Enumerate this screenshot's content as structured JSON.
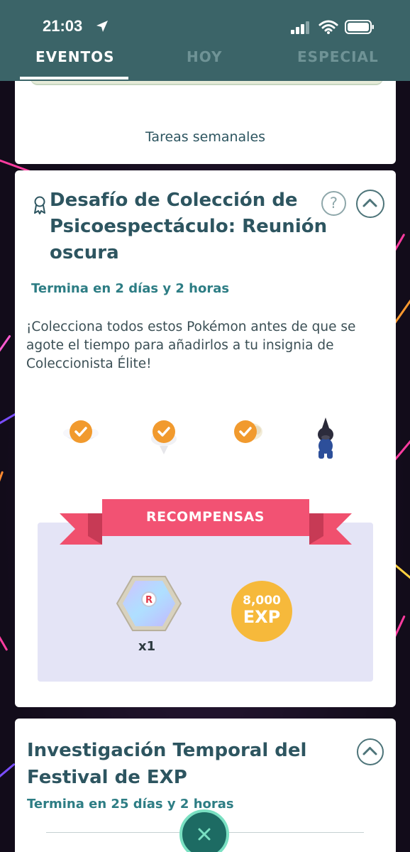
{
  "status_bar": {
    "time": "21:03",
    "icons": [
      "location-arrow-icon",
      "cellular-signal-icon",
      "wifi-icon",
      "battery-icon"
    ]
  },
  "tabs": [
    {
      "label": "EVENTOS",
      "active": true
    },
    {
      "label": "HOY",
      "active": false
    },
    {
      "label": "ESPECIAL",
      "active": false
    }
  ],
  "weekly_card": {
    "label": "Tareas semanales"
  },
  "challenge": {
    "title": "Desafío de Colección de Psicoespectáculo: Reunión oscura",
    "ends": "Termina en 2 días y 2 horas",
    "description": "¡Colecciona todos estos Pokémon antes de que se agote el tiempo para añadirlos a tu insignia de Coleccionista Élite!",
    "pokemon": [
      {
        "collected": true
      },
      {
        "collected": true
      },
      {
        "collected": true
      },
      {
        "collected": false
      }
    ],
    "rewards": {
      "title": "RECOMPENSAS",
      "items": [
        {
          "icon": "rocket-radar-icon",
          "quantity": "x1"
        },
        {
          "icon": "exp-icon",
          "amount": "8,000",
          "label": "EXP"
        }
      ]
    }
  },
  "research": {
    "title": "Investigación Temporal del Festival de EXP",
    "ends": "Termina en 25 días y 2 horas"
  },
  "colors": {
    "header": "#3b6468",
    "accent_teal": "#2d7d84",
    "check_orange": "#f19a2e",
    "ribbon_red": "#f0506e",
    "exp_gold": "#f6b93b",
    "rewards_bg": "#e4e4f6"
  }
}
